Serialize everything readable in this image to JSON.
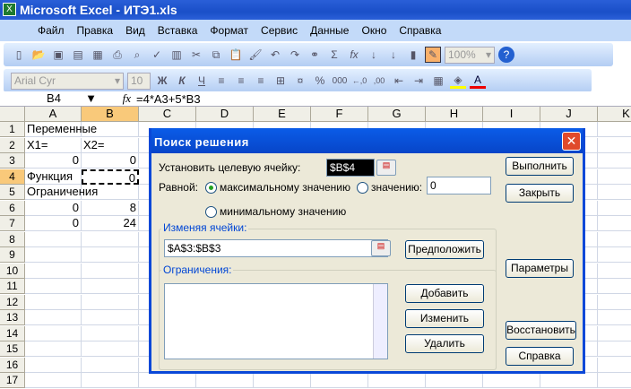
{
  "window": {
    "title": "Microsoft Excel - ИТЭ1.xls",
    "app_icon": "excel-icon"
  },
  "menu": [
    "Файл",
    "Правка",
    "Вид",
    "Вставка",
    "Формат",
    "Сервис",
    "Данные",
    "Окно",
    "Справка"
  ],
  "toolbar": {
    "zoom": "100%",
    "font": "Arial Cyr",
    "size": "10",
    "bold": "Ж",
    "italic": "К",
    "underline": "Ч",
    "percent": "%",
    "thousands": "000",
    "sum": "Σ",
    "fx": "fx"
  },
  "formula_bar": {
    "name_box": "B4",
    "fx_label": "fx",
    "formula": "=4*A3+5*B3"
  },
  "columns": [
    "A",
    "B",
    "C",
    "D",
    "E",
    "F",
    "G",
    "H",
    "I",
    "J",
    "K"
  ],
  "rows": [
    "1",
    "2",
    "3",
    "4",
    "5",
    "6",
    "7",
    "8",
    "9",
    "10",
    "11",
    "12",
    "13",
    "14",
    "15",
    "16",
    "17"
  ],
  "cells": {
    "A1": "Переменные",
    "A2": "X1=",
    "B2": "X2=",
    "A3": "0",
    "B3": "0",
    "A4": "Функция",
    "B4": "0",
    "A5": "Ограничения",
    "A6": "0",
    "B6": "8",
    "A7": "0",
    "B7": "24"
  },
  "dialog": {
    "title": "Поиск решения",
    "target_label": "Установить целевую ячейку:",
    "target_value": "$B$4",
    "equal_label": "Равной:",
    "opt_max": "максимальному значению",
    "opt_value": "значению:",
    "value_input": "0",
    "opt_min": "минимальному значению",
    "changing_label": "Изменяя ячейки:",
    "changing_value": "$A$3:$B$3",
    "guess": "Предположить",
    "constraints_label": "Ограничения:",
    "add": "Добавить",
    "change": "Изменить",
    "delete": "Удалить",
    "solve": "Выполнить",
    "close": "Закрыть",
    "options": "Параметры",
    "reset": "Восстановить",
    "help": "Справка"
  }
}
